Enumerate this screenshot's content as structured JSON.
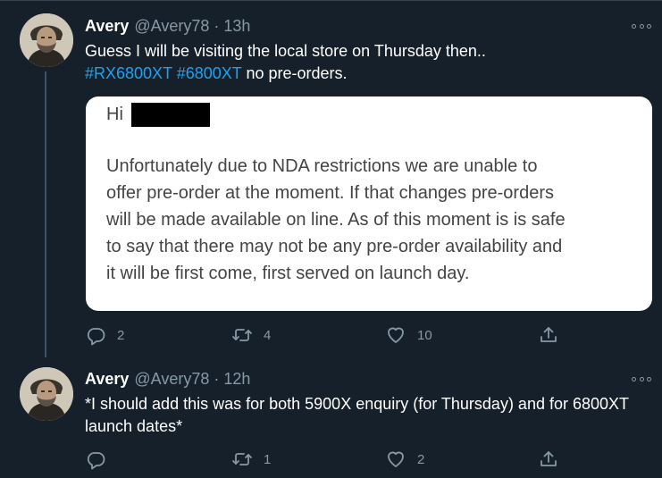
{
  "tweets": [
    {
      "author": {
        "name": "Avery",
        "handle": "@Avery78"
      },
      "separator": "·",
      "time": "13h",
      "lines": [
        {
          "plain": "Guess I will be visiting the local store on Thursday then.."
        },
        {
          "hashtags": [
            "#RX6800XT",
            "#6800XT"
          ],
          "suffix": " no pre-orders."
        }
      ],
      "card": {
        "greeting": "Hi",
        "body": [
          "Unfortunately due to NDA restrictions we are unable to",
          "offer pre-order at the moment. If that changes pre-orders",
          "will be made available on line. As of this moment is is safe",
          "to say that there may not be any pre-order availability and",
          "it will be first come, first served on launch day."
        ]
      },
      "actions": {
        "replies": "2",
        "retweets": "4",
        "likes": "10"
      }
    },
    {
      "author": {
        "name": "Avery",
        "handle": "@Avery78"
      },
      "separator": "·",
      "time": "12h",
      "lines": [
        "*I should add this was for both 5900X enquiry (for Thursday) and for 6800XT",
        "launch dates*"
      ],
      "actions": {
        "replies": "",
        "retweets": "1",
        "likes": "2"
      }
    }
  ],
  "icons": {
    "reply": "reply-icon",
    "retweet": "retweet-icon",
    "like": "like-icon",
    "share": "share-icon",
    "more": "more-options-icon"
  },
  "colors": {
    "background": "#15202b",
    "text": "#ffffff",
    "muted": "#8899a6",
    "hashtag": "#1da1f2",
    "thread_line": "#3d5466"
  }
}
